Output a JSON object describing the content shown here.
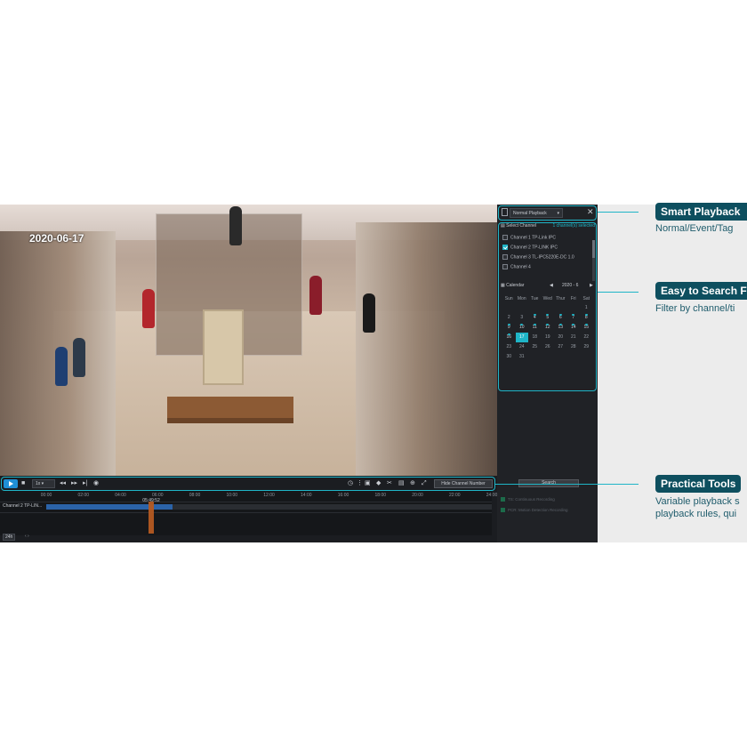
{
  "video": {
    "timestamp": "2020-06-17"
  },
  "playback": {
    "mode": "Normal Playback",
    "mode_arrow": "▾",
    "close": "✕"
  },
  "channels": {
    "header": "Select Channel",
    "selected": "1 channel(s) selected",
    "items": [
      {
        "label": "Channel 1 TP-Link IPC",
        "checked": false
      },
      {
        "label": "Channel 2 TP-LINK IPC",
        "checked": true
      },
      {
        "label": "Channel 3 TL-IPC5220E-DC 1.0",
        "checked": false
      },
      {
        "label": "Channel 4",
        "checked": false
      }
    ]
  },
  "calendar": {
    "label": "Calendar",
    "month": "2020 - 6",
    "prev": "◀",
    "next": "▶",
    "weekdays": [
      "Sun",
      "Mon",
      "Tue",
      "Wed",
      "Thur",
      "Fri",
      "Sat"
    ],
    "weeks": [
      [
        "",
        "",
        "",
        "",
        "",
        "",
        "1"
      ],
      [
        "2",
        "3",
        "4",
        "5",
        "6",
        "7",
        "8"
      ],
      [
        "9",
        "10",
        "11",
        "12",
        "13",
        "14",
        "15"
      ],
      [
        "16",
        "17",
        "18",
        "19",
        "20",
        "21",
        "22"
      ],
      [
        "23",
        "24",
        "25",
        "26",
        "27",
        "28",
        "29"
      ],
      [
        "30",
        "31",
        "",
        "",
        "",
        "",
        ""
      ]
    ],
    "today": "17"
  },
  "search": {
    "label": "Search"
  },
  "legend": [
    {
      "label": "TS: Continuous Recording",
      "color": "#1c6b4a"
    },
    {
      "label": "PCR: Motion Detection Recording",
      "color": "#1c6b4a"
    }
  ],
  "toolbar": {
    "speed": "1x",
    "hide_label": "Hide Channel Number"
  },
  "timeline": {
    "ticks": [
      "00:00",
      "02:00",
      "04:00",
      "06:00",
      "08:00",
      "10:00",
      "12:00",
      "14:00",
      "16:00",
      "18:00",
      "20:00",
      "22:00",
      "24:00"
    ],
    "cursor_time": "05:49:52",
    "channel_label": "Channel 2 TP-LIN...",
    "zoom": "24h",
    "zoom_arrows": "‹ ›"
  },
  "callouts": [
    {
      "title": "Smart Playback",
      "desc": "Normal/Event/Tag"
    },
    {
      "title": "Easy to Search F",
      "desc": "Filter by channel/ti"
    },
    {
      "title": "Practical Tools",
      "desc1": "Variable playback s",
      "desc2": "playback rules, qui"
    }
  ],
  "colors": {
    "accent": "#1fb5c7",
    "callout_bg": "#0e4f5f",
    "recording": "#2b63a8",
    "cursor": "#b45a22"
  }
}
